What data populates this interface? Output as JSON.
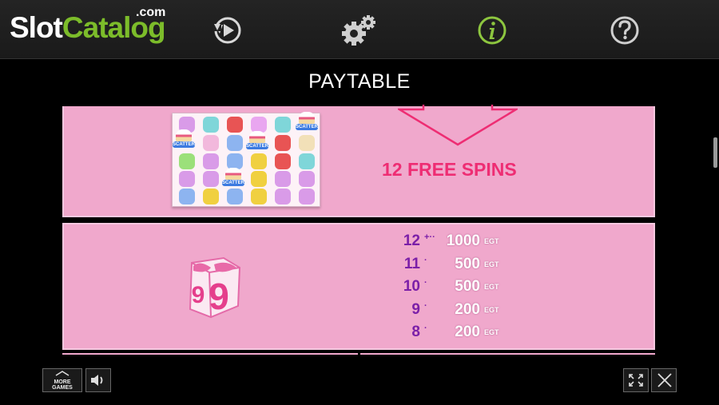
{
  "logo": {
    "slot": "Slot",
    "catalog": "Catalog",
    "com": ".com"
  },
  "toolbar": {
    "icons": [
      "replay-icon",
      "settings-gears-icon",
      "info-icon",
      "help-icon"
    ]
  },
  "title": "PAYTABLE",
  "feature": {
    "text": "12 FREE SPINS",
    "scatter_label": "SCATTER"
  },
  "paytable": [
    {
      "count": "12",
      "amount": "1000",
      "currency": "EGT"
    },
    {
      "count": "11",
      "amount": "500",
      "currency": "EGT"
    },
    {
      "count": "10",
      "amount": "500",
      "currency": "EGT"
    },
    {
      "count": "9",
      "amount": "200",
      "currency": "EGT"
    },
    {
      "count": "8",
      "amount": "200",
      "currency": "EGT"
    }
  ],
  "bottom": {
    "more_games_line1": "MORE",
    "more_games_line2": "GAMES"
  },
  "colors": {
    "panel": "#f0a8cc",
    "free_spins": "#ee2d73",
    "count": "#7b1fa8",
    "brand_green": "#7cbc2a"
  }
}
